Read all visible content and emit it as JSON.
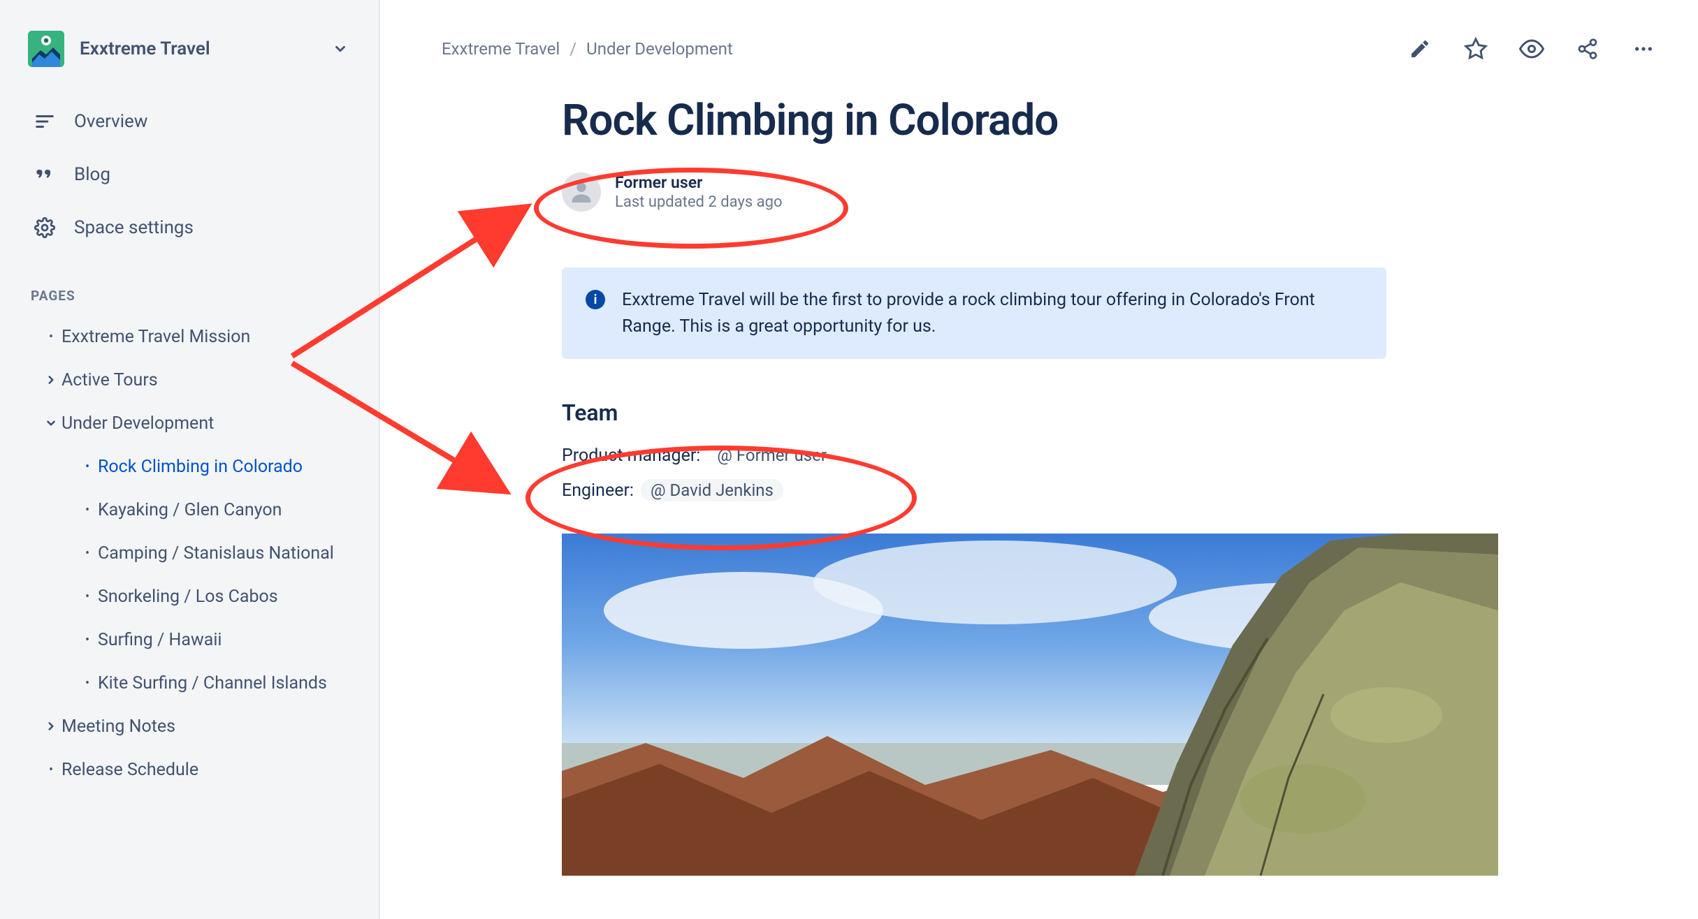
{
  "sidebar": {
    "space_name": "Exxtreme Travel",
    "nav": [
      {
        "label": "Overview"
      },
      {
        "label": "Blog"
      },
      {
        "label": "Space settings"
      }
    ],
    "section_label": "PAGES",
    "tree": [
      {
        "label": "Exxtreme Travel Mission",
        "level": 1,
        "icon": "bullet"
      },
      {
        "label": "Active Tours",
        "level": 1,
        "icon": "chevron-right"
      },
      {
        "label": "Under Development",
        "level": 1,
        "icon": "chevron-down"
      },
      {
        "label": "Rock Climbing in Colorado",
        "level": 2,
        "icon": "bullet",
        "selected": true
      },
      {
        "label": "Kayaking / Glen Canyon",
        "level": 2,
        "icon": "bullet"
      },
      {
        "label": "Camping / Stanislaus National",
        "level": 2,
        "icon": "bullet"
      },
      {
        "label": "Snorkeling / Los Cabos",
        "level": 2,
        "icon": "bullet"
      },
      {
        "label": "Surfing / Hawaii",
        "level": 2,
        "icon": "bullet"
      },
      {
        "label": "Kite Surfing / Channel Islands",
        "level": 2,
        "icon": "bullet"
      },
      {
        "label": "Meeting Notes",
        "level": 1,
        "icon": "chevron-right"
      },
      {
        "label": "Release Schedule",
        "level": 1,
        "icon": "bullet"
      }
    ]
  },
  "breadcrumbs": {
    "items": [
      "Exxtreme Travel",
      "Under Development"
    ]
  },
  "page": {
    "title": "Rock Climbing in Colorado",
    "author": "Former user",
    "updated": "Last updated 2 days ago",
    "info_panel": "Exxtreme Travel will be the first to provide a rock climbing tour offering in Colorado's Front Range. This is a great opportunity for us.",
    "team_heading": "Team",
    "team": [
      {
        "role": "Product manager:",
        "mention": "@ Former user",
        "former": true
      },
      {
        "role": "Engineer:",
        "mention": "@ David Jenkins",
        "former": false
      }
    ]
  },
  "colors": {
    "accent": "#0052cc",
    "info_bg": "#deebff",
    "annotation": "#ff3b30"
  }
}
